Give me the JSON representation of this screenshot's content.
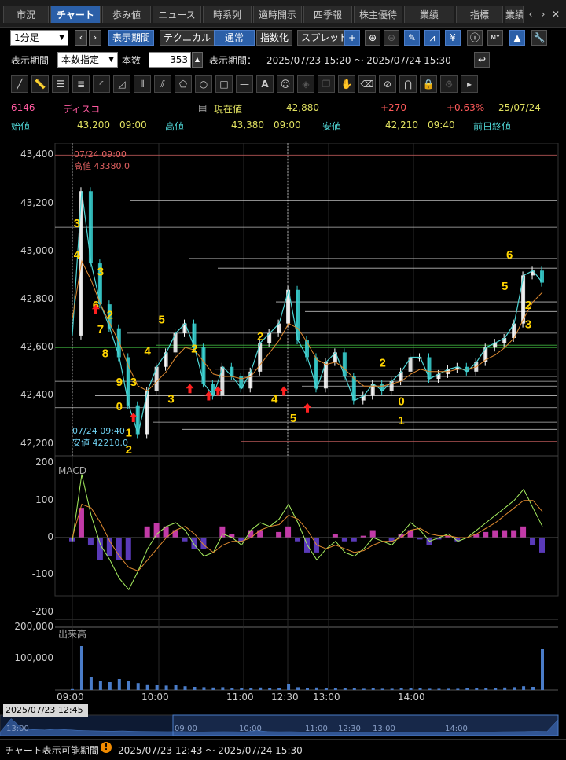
{
  "tabs": [
    {
      "label": "市況",
      "active": false
    },
    {
      "label": "チャート",
      "active": true
    },
    {
      "label": "歩み値",
      "active": false
    },
    {
      "label": "ニュース",
      "active": false
    },
    {
      "label": "時系列",
      "active": false
    },
    {
      "label": "適時開示",
      "active": false
    },
    {
      "label": "四季報",
      "active": false
    },
    {
      "label": "株主優待",
      "active": false
    },
    {
      "label": "業績",
      "active": false
    },
    {
      "label": "指標",
      "active": false
    },
    {
      "label": "業績",
      "active": false
    }
  ],
  "toolbar": {
    "timeframe": "1分足",
    "period_button": "表示期間",
    "technical_button": "テクニカル",
    "normal_button": "通常",
    "index_button": "指数化",
    "spread_button": "スプレッド",
    "icons": [
      "add-icon",
      "zoom-in-icon",
      "zoom-out-icon",
      "pencil-icon",
      "candle-icon",
      "yen-icon",
      "info-icon",
      "my-icon",
      "mountain-chart-icon",
      "wrench-icon"
    ]
  },
  "period_row": {
    "label": "表示期間",
    "mode": "本数指定",
    "count_label": "本数",
    "count": "353",
    "range_label": "表示期間：",
    "range": "2025/07/23 15:20 ～ 2025/07/24 15:30"
  },
  "quote": {
    "code": "6146",
    "name": "ディスコ",
    "current_label": "現在値",
    "current": "42,880",
    "change": "+270",
    "change_pct": "+0.63%",
    "date": "25/07/24",
    "open_label": "始値",
    "open": "43,200",
    "open_time": "09:00",
    "high_label": "高値",
    "high": "43,380",
    "high_time": "09:00",
    "low_label": "安値",
    "low": "42,210",
    "low_time": "09:40",
    "prev_close_label": "前日終値"
  },
  "chart": {
    "high_marker_time": "07/24 09:00",
    "high_marker_text": "高値 43380.0",
    "low_marker_time": "07/24 09:40",
    "low_marker_text": "安値 42210.0",
    "macd_label": "MACD",
    "volume_label": "出来高",
    "date_box": "2025/07/23 12:45"
  },
  "chart_data": {
    "type": "line",
    "price_yaxis": [
      "43,400",
      "43,200",
      "43,000",
      "42,800",
      "42,600",
      "42,400",
      "42,200"
    ],
    "macd_yaxis": [
      "200",
      "100",
      "0",
      "-100",
      "-200"
    ],
    "volume_yaxis": [
      "200,000",
      "100,000"
    ],
    "xaxis": [
      "09:00",
      "10:00",
      "11:00",
      "12:30",
      "13:00",
      "14:00"
    ],
    "navigator_xaxis": [
      "13:00",
      "09:00",
      "10:00",
      "11:00",
      "12:30",
      "13:00",
      "14:00"
    ],
    "ylim": [
      42150,
      43450
    ],
    "price_x": [
      0,
      2,
      4,
      6,
      8,
      10,
      12,
      14,
      16,
      18,
      20,
      22,
      24,
      26,
      28,
      30,
      32,
      34,
      36,
      38,
      40,
      42,
      44,
      46,
      48,
      50,
      52,
      54,
      56,
      58,
      60,
      62,
      64,
      66,
      68,
      70,
      72,
      74,
      76,
      78,
      80,
      82,
      84,
      86,
      88,
      90,
      92,
      94,
      96,
      98,
      100
    ],
    "price": [
      42650,
      43250,
      42950,
      42780,
      42680,
      42560,
      42360,
      42240,
      42420,
      42520,
      42580,
      42660,
      42700,
      42600,
      42450,
      42400,
      42520,
      42480,
      42430,
      42500,
      42620,
      42660,
      42700,
      42840,
      42630,
      42560,
      42430,
      42540,
      42580,
      42480,
      42380,
      42400,
      42450,
      42420,
      42460,
      42500,
      42560,
      42560,
      42470,
      42490,
      42510,
      42520,
      42500,
      42540,
      42600,
      42620,
      42640,
      42700,
      42900,
      42920,
      42870
    ],
    "ma_price": [
      42720,
      42960,
      42880,
      42780,
      42700,
      42620,
      42520,
      42440,
      42420,
      42460,
      42500,
      42560,
      42600,
      42590,
      42540,
      42490,
      42480,
      42480,
      42470,
      42480,
      42530,
      42580,
      42630,
      42700,
      42680,
      42620,
      42550,
      42530,
      42540,
      42510,
      42470,
      42440,
      42440,
      42440,
      42450,
      42460,
      42490,
      42510,
      42500,
      42500,
      42500,
      42510,
      42510,
      42520,
      42550,
      42570,
      42600,
      42640,
      42720,
      42790,
      42830
    ],
    "hlines": [
      43400,
      43380,
      43210,
      43100,
      42970,
      42930,
      42860,
      42790,
      42750,
      42710,
      42660,
      42610,
      42600,
      42510,
      42480,
      42460,
      42440,
      42400,
      42350,
      42290,
      42260,
      42220,
      42210
    ],
    "labels": [
      {
        "text": "3",
        "x": 1,
        "y": 43100
      },
      {
        "text": "4",
        "x": 1,
        "y": 42970
      },
      {
        "text": "3",
        "x": 6,
        "y": 42900
      },
      {
        "text": "6",
        "x": 5,
        "y": 42760
      },
      {
        "text": "2",
        "x": 8,
        "y": 42720
      },
      {
        "text": "7",
        "x": 6,
        "y": 42660
      },
      {
        "text": "8",
        "x": 7,
        "y": 42560
      },
      {
        "text": "9",
        "x": 10,
        "y": 42440
      },
      {
        "text": "0",
        "x": 10,
        "y": 42340
      },
      {
        "text": "3",
        "x": 13,
        "y": 42440
      },
      {
        "text": "1",
        "x": 12,
        "y": 42230
      },
      {
        "text": "2",
        "x": 12,
        "y": 42160
      },
      {
        "text": "4",
        "x": 16,
        "y": 42570
      },
      {
        "text": "5",
        "x": 19,
        "y": 42700
      },
      {
        "text": "3",
        "x": 21,
        "y": 42370
      },
      {
        "text": "2",
        "x": 26,
        "y": 42580
      },
      {
        "text": "2",
        "x": 40,
        "y": 42630
      },
      {
        "text": "4",
        "x": 43,
        "y": 42370
      },
      {
        "text": "5",
        "x": 47,
        "y": 42290
      },
      {
        "text": "2",
        "x": 66,
        "y": 42520
      },
      {
        "text": "0",
        "x": 70,
        "y": 42360
      },
      {
        "text": "1",
        "x": 70,
        "y": 42280
      },
      {
        "text": "6",
        "x": 93,
        "y": 42970
      },
      {
        "text": "5",
        "x": 92,
        "y": 42840
      },
      {
        "text": "2",
        "x": 97,
        "y": 42760
      },
      {
        "text": "3",
        "x": 97,
        "y": 42680
      }
    ],
    "arrows": [
      {
        "x": 5,
        "y": 42760
      },
      {
        "x": 13,
        "y": 42310
      },
      {
        "x": 25,
        "y": 42430
      },
      {
        "x": 29,
        "y": 42400
      },
      {
        "x": 31,
        "y": 42420
      },
      {
        "x": 45,
        "y": 42420
      },
      {
        "x": 50,
        "y": 42350
      }
    ],
    "macd_ylim": [
      -220,
      220
    ],
    "macd_x": [
      0,
      2,
      4,
      6,
      8,
      10,
      12,
      14,
      16,
      18,
      20,
      22,
      24,
      26,
      28,
      30,
      32,
      34,
      36,
      38,
      40,
      42,
      44,
      46,
      48,
      50,
      52,
      54,
      56,
      58,
      60,
      62,
      64,
      66,
      68,
      70,
      72,
      74,
      76,
      78,
      80,
      82,
      84,
      86,
      88,
      90,
      92,
      94,
      96,
      98,
      100
    ],
    "macd": [
      -10,
      170,
      60,
      -20,
      -60,
      -110,
      -140,
      -90,
      -30,
      10,
      30,
      40,
      20,
      -20,
      -50,
      -40,
      10,
      0,
      -20,
      20,
      40,
      30,
      50,
      90,
      40,
      -20,
      -60,
      -30,
      -10,
      -40,
      -50,
      -30,
      0,
      -10,
      -20,
      10,
      40,
      20,
      -10,
      0,
      10,
      -10,
      0,
      20,
      40,
      60,
      80,
      100,
      130,
      80,
      30
    ],
    "macd_signal": [
      0,
      90,
      80,
      40,
      -10,
      -50,
      -80,
      -90,
      -60,
      -30,
      0,
      20,
      30,
      10,
      -20,
      -40,
      -20,
      -10,
      -10,
      0,
      20,
      30,
      35,
      60,
      50,
      20,
      -20,
      -30,
      -20,
      -30,
      -40,
      -35,
      -20,
      -10,
      -10,
      0,
      20,
      25,
      10,
      5,
      5,
      0,
      0,
      10,
      25,
      40,
      60,
      80,
      100,
      100,
      70
    ],
    "volume_ylim": [
      0,
      200000
    ],
    "volume_x": [
      0,
      2,
      4,
      6,
      8,
      10,
      12,
      14,
      16,
      18,
      20,
      22,
      24,
      26,
      28,
      30,
      32,
      34,
      36,
      38,
      40,
      42,
      44,
      46,
      48,
      50,
      52,
      54,
      56,
      58,
      60,
      62,
      64,
      66,
      68,
      70,
      72,
      74,
      76,
      78,
      80,
      82,
      84,
      86,
      88,
      90,
      92,
      94,
      96,
      98,
      100
    ],
    "volume": [
      3000,
      140000,
      40000,
      30000,
      25000,
      35000,
      28000,
      22000,
      18000,
      15000,
      14000,
      16000,
      12000,
      10000,
      9000,
      8000,
      9000,
      7000,
      6000,
      7000,
      8000,
      7000,
      6000,
      20000,
      9000,
      7000,
      8000,
      6000,
      5000,
      6000,
      5000,
      4000,
      5000,
      4000,
      4000,
      5000,
      6000,
      5000,
      4000,
      4000,
      4000,
      4000,
      5000,
      5000,
      6000,
      7000,
      8000,
      9000,
      12000,
      10000,
      130000
    ]
  },
  "status": {
    "label": "チャート表示可能期間",
    "range": "2025/07/23 12:43 ～ 2025/07/24 15:30"
  },
  "colors": {
    "active_tab": "#2b5fa8",
    "candle_up": "#ffffff",
    "candle_down": "#3ad3d3",
    "label_yellow": "#ffd400",
    "arrow_red": "#ff2020",
    "macd_hist_pos": "#c23aa7",
    "macd_hist_neg": "#5a3ab8",
    "change_red": "#ff5a5a"
  }
}
